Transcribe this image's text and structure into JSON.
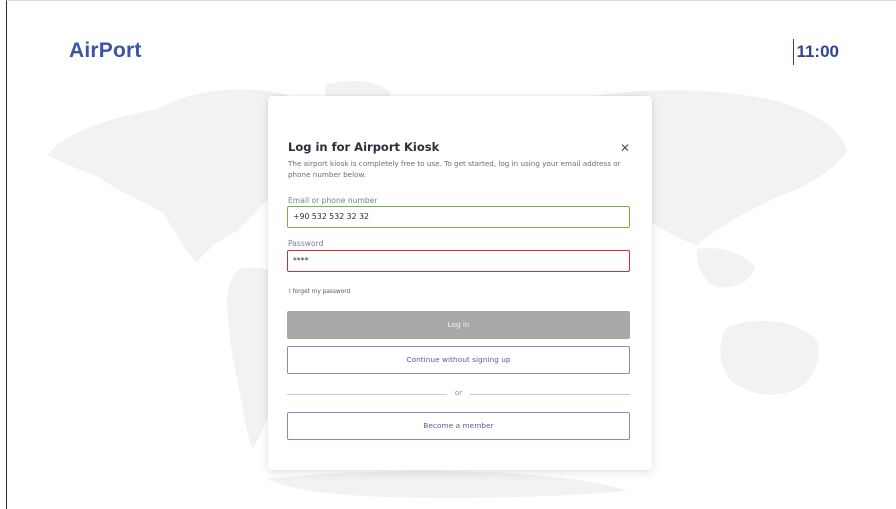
{
  "header": {
    "logo": "AirPort",
    "time": "11:00"
  },
  "modal": {
    "title": "Log in for Airport Kiosk",
    "description": "The airport kiosk is completely free to use. To get started, log in using your email address or phone number below.",
    "email_label": "Email or phone number",
    "email_value": "+90 532 532 32 32",
    "password_label": "Password",
    "password_value": "****",
    "forgot_link": "I forget my password",
    "login_button": "Log in",
    "guest_button": "Continue without signing up",
    "divider_text": "or",
    "member_button": "Become a member",
    "close_icon": "close-icon"
  },
  "colors": {
    "brand": "#3b54a6",
    "valid_border": "#7cb342",
    "error_border": "#d32f2f",
    "disabled_button": "#a8aaa9",
    "outline_button": "#8e84c9"
  }
}
